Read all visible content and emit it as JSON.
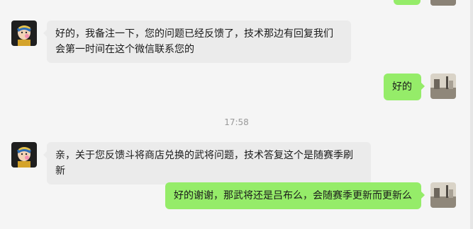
{
  "chat": {
    "timestamp": "17:58",
    "messages": [
      {
        "from": "other",
        "text": "好的，我备注一下，您的问题已经反馈了，技术那边有回复我们会第一时间在这个微信联系您的"
      },
      {
        "from": "me",
        "text": "好的"
      },
      {
        "from": "other",
        "text": "亲，关于您反馈斗将商店兑换的武将问题，技术答复这个是随赛季刷新"
      },
      {
        "from": "me",
        "text": "好的谢谢，那武将还是吕布么，会随赛季更新而更新么"
      }
    ]
  },
  "colors": {
    "incoming_bubble": "#ebebeb",
    "outgoing_bubble": "#95ec69",
    "background": "#f5f5f5",
    "timestamp_text": "#999999"
  }
}
